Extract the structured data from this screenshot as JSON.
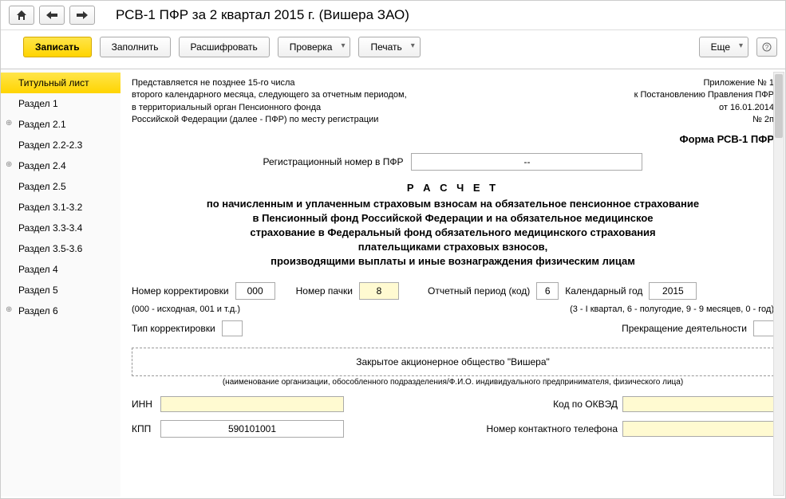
{
  "title": "РСВ-1 ПФР за 2 квартал 2015 г. (Вишера ЗАО)",
  "toolbar": {
    "save": "Записать",
    "fill": "Заполнить",
    "decode": "Расшифровать",
    "check": "Проверка",
    "print": "Печать",
    "more": "Еще"
  },
  "sidebar": {
    "items": [
      {
        "label": "Титульный лист",
        "active": true,
        "exp": false
      },
      {
        "label": "Раздел 1",
        "active": false,
        "exp": false
      },
      {
        "label": "Раздел 2.1",
        "active": false,
        "exp": true
      },
      {
        "label": "Раздел 2.2-2.3",
        "active": false,
        "exp": false
      },
      {
        "label": "Раздел 2.4",
        "active": false,
        "exp": true
      },
      {
        "label": "Раздел 2.5",
        "active": false,
        "exp": false
      },
      {
        "label": "Раздел 3.1-3.2",
        "active": false,
        "exp": false
      },
      {
        "label": "Раздел 3.3-3.4",
        "active": false,
        "exp": false
      },
      {
        "label": "Раздел 3.5-3.6",
        "active": false,
        "exp": false
      },
      {
        "label": "Раздел 4",
        "active": false,
        "exp": false
      },
      {
        "label": "Раздел 5",
        "active": false,
        "exp": false
      },
      {
        "label": "Раздел 6",
        "active": false,
        "exp": true
      }
    ]
  },
  "header": {
    "left1": "Представляется не позднее 15-го числа",
    "left2": "второго календарного месяца, следующего за отчетным периодом,",
    "left3": "в территориальный орган Пенсионного фонда",
    "left4": "Российской Федерации (далее - ПФР) по месту регистрации",
    "right1": "Приложение № 1",
    "right2": "к Постановлению Правления ПФР",
    "right3": "от 16.01.2014",
    "right4": "№ 2п"
  },
  "form_title": "Форма РСВ-1 ПФР",
  "reg": {
    "label": "Регистрационный номер в ПФР",
    "value": "--"
  },
  "calc": {
    "title": "Р А С Ч Е Т",
    "line1": "по начисленным и уплаченным страховым взносам на обязательное пенсионное страхование",
    "line2": "в Пенсионный фонд Российской Федерации и на обязательное медицинское",
    "line3": "страхование в Федеральный фонд обязательного медицинского страхования",
    "line4": "плательщиками страховых взносов,",
    "line5": "производящими выплаты и иные вознаграждения физическим лицам"
  },
  "fields": {
    "corr_num_label": "Номер корректировки",
    "corr_num": "000",
    "corr_hint": "(000 - исходная, 001 и т.д.)",
    "pack_label": "Номер пачки",
    "pack": "8",
    "period_label": "Отчетный период (код)",
    "period": "6",
    "year_label": "Календарный год",
    "year": "2015",
    "period_hint": "(3 - I квартал, 6 - полугодие, 9 - 9 месяцев, 0 - год)",
    "corr_type_label": "Тип корректировки",
    "corr_type": "",
    "cease_label": "Прекращение деятельности",
    "cease": "",
    "org_name": "Закрытое акционерное общество \"Вишера\"",
    "org_hint": "(наименование организации, обособленного подразделения/Ф.И.О. индивидуального предпринимателя, физического лица)",
    "inn_label": "ИНН",
    "inn": "",
    "okved_label": "Код по ОКВЭД",
    "okved": "",
    "kpp_label": "КПП",
    "kpp": "590101001",
    "phone_label": "Номер контактного телефона",
    "phone": ""
  }
}
